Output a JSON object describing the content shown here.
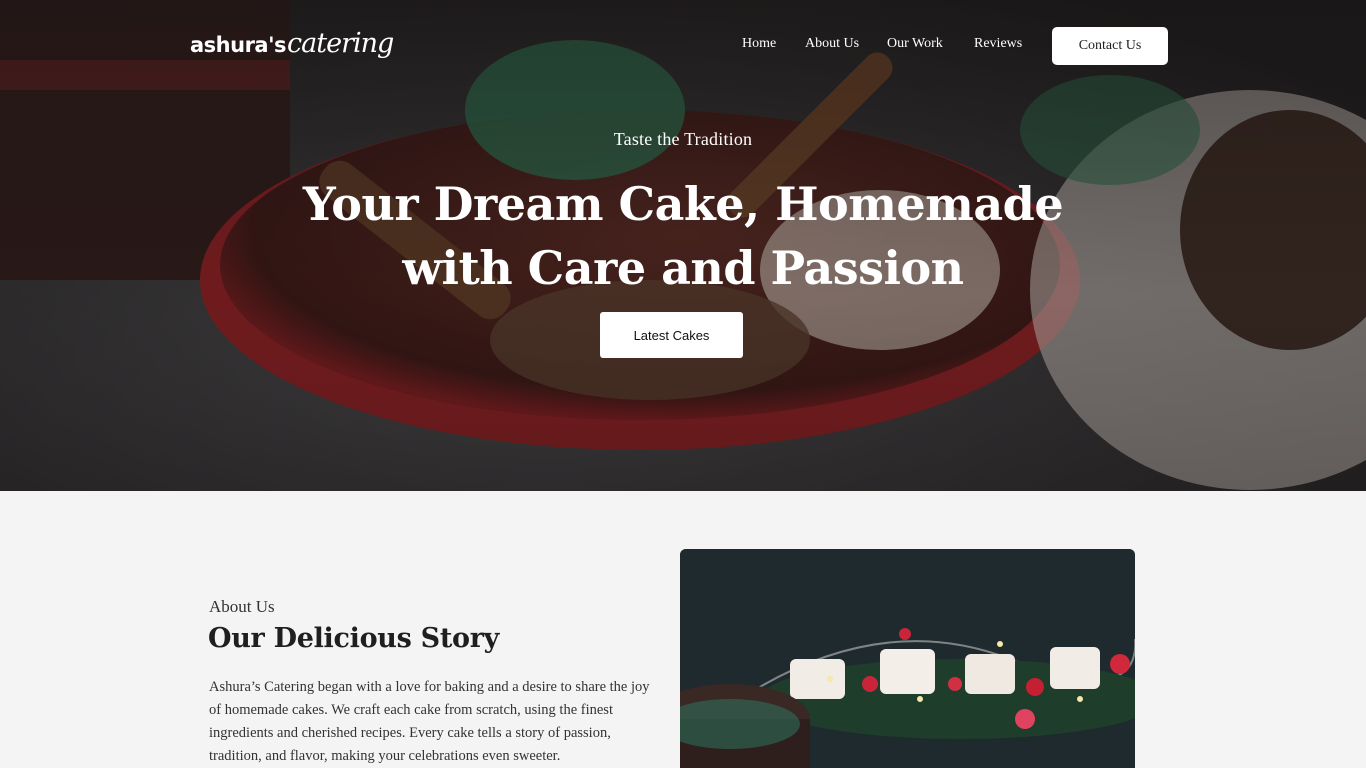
{
  "brand": {
    "logo_bold": "ashura's",
    "logo_script": "catering"
  },
  "nav": {
    "items": [
      {
        "label": "Home"
      },
      {
        "label": "About Us"
      },
      {
        "label": "Our Work"
      },
      {
        "label": "Reviews"
      }
    ],
    "contact_label": "Contact Us"
  },
  "hero": {
    "tagline": "Taste the Tradition",
    "headline_line1": "Your Dream Cake, Homemade",
    "headline_line2": "with Care and Passion",
    "cta_label": "Latest Cakes",
    "image_description_icon": "dessert-photo-icon"
  },
  "about": {
    "eyebrow": "About Us",
    "title": "Our Delicious Story",
    "body": "Ashura’s Catering began with a love for baking and a desire to share the joy of homemade cakes. We craft each cake from scratch, using the finest ingredients and cherished recipes. Every cake tells a story of passion, tradition, and flavor, making your celebrations even sweeter.",
    "image_icon": "festive-candles-photo-icon"
  },
  "colors": {
    "accent_white": "#ffffff",
    "page_background": "#f4f4f4",
    "hero_dark": "#2a2422",
    "tin_red": "#8e1f22"
  }
}
